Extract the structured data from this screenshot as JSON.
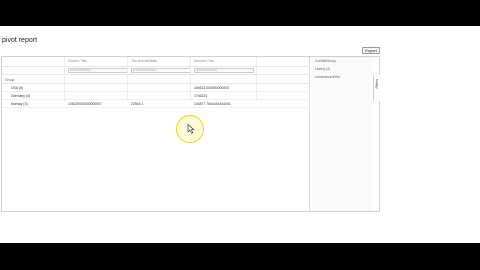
{
  "page": {
    "title": "pivot report",
    "export_label": "Export"
  },
  "grid": {
    "columns": [
      {
        "header": "Closed / Yes",
        "dropdown": "(summarized/Yes)"
      },
      {
        "header": "Thu at end/Neate",
        "dropdown": "(summarized/Neate)"
      },
      {
        "header": "Amount / Yes",
        "dropdown": "(summarized/Yes)"
      }
    ],
    "group_label": "Group",
    "rows": [
      {
        "label": "USA (5)",
        "cells": [
          "",
          "",
          "184613.000000000000"
        ]
      },
      {
        "label": "Germany (4)",
        "cells": [
          "",
          "",
          "1746224"
        ]
      },
      {
        "label": "Norway (3)",
        "cells": [
          "106220000000000007",
          "22944.1",
          "104877.7844444444451"
        ]
      }
    ]
  },
  "fields": {
    "items": [
      "ConfiletGroup",
      "Liberty (2)",
      "summarized/Yes"
    ],
    "filters_label": "Filters"
  },
  "colors": {
    "cursor_highlight": "#f2d30f"
  }
}
